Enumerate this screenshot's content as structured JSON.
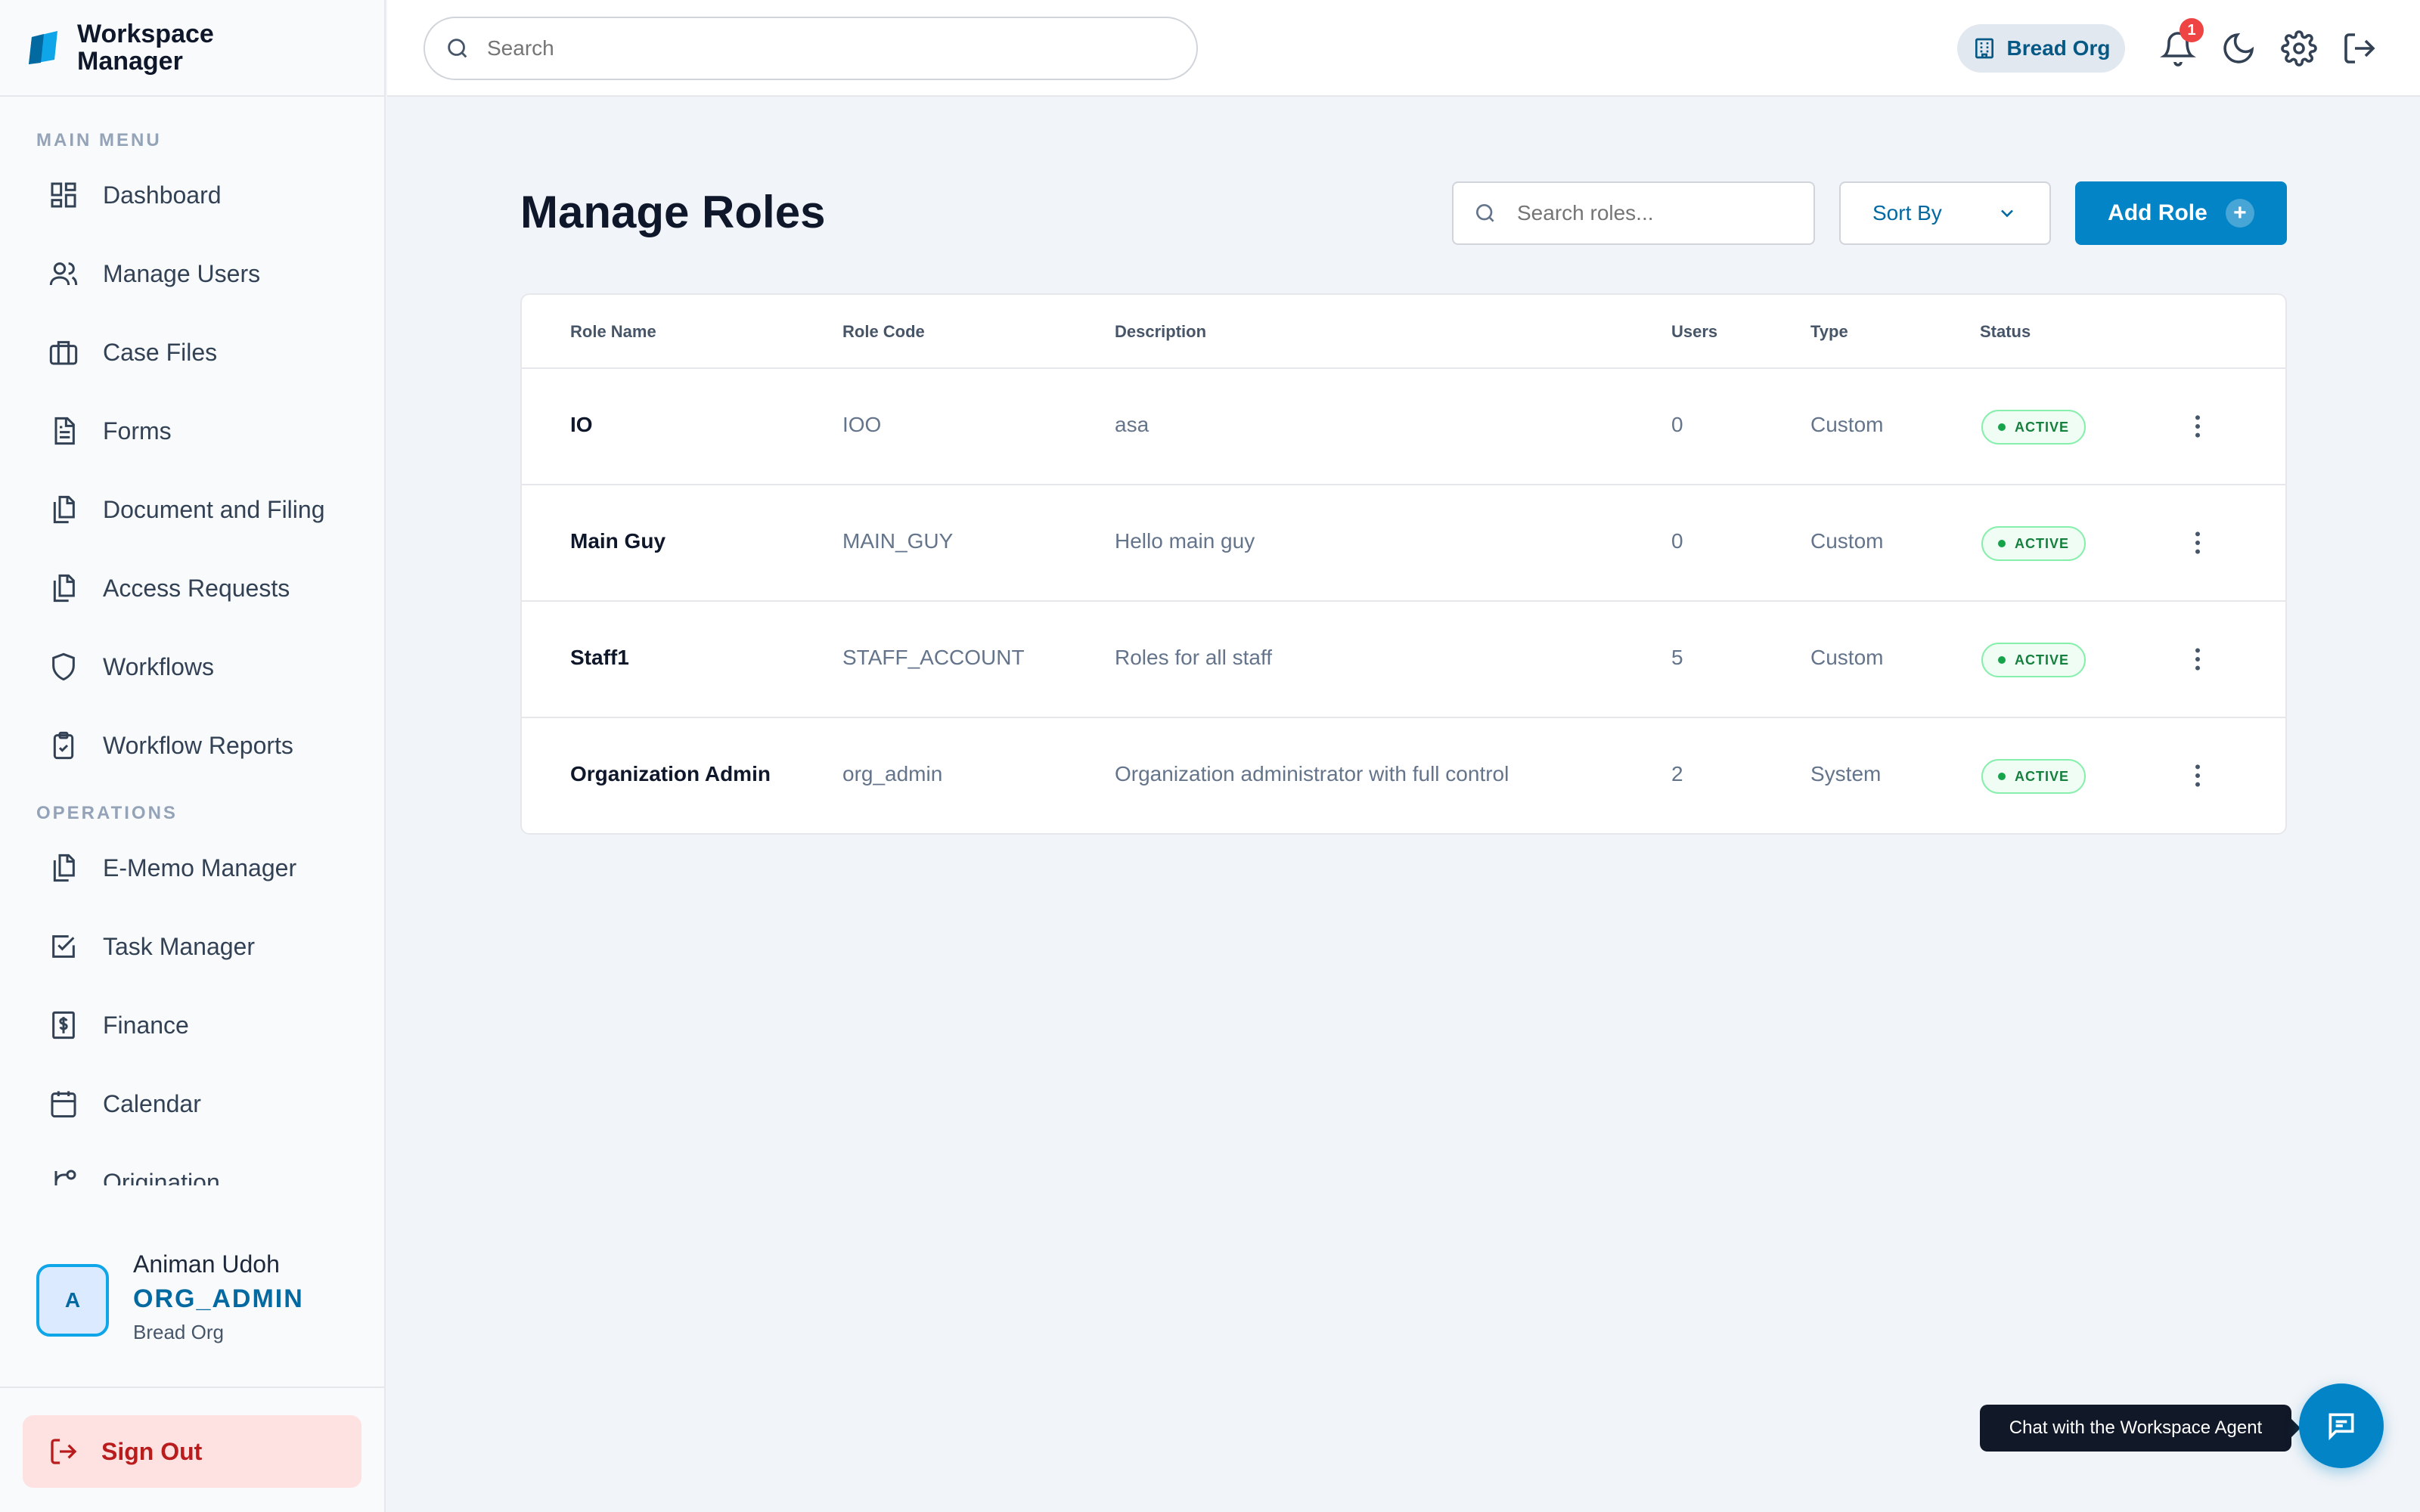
{
  "brand": {
    "line1": "Workspace",
    "line2": "Manager"
  },
  "sidebar": {
    "main_label": "MAIN MENU",
    "main_items": [
      {
        "label": "Dashboard",
        "icon": "dashboard-icon"
      },
      {
        "label": "Manage Users",
        "icon": "users-icon"
      },
      {
        "label": "Case Files",
        "icon": "briefcase-icon"
      },
      {
        "label": "Forms",
        "icon": "document-icon"
      },
      {
        "label": "Document and Filing",
        "icon": "files-icon"
      },
      {
        "label": "Access Requests",
        "icon": "files-icon"
      },
      {
        "label": "Workflows",
        "icon": "shield-icon"
      },
      {
        "label": "Workflow Reports",
        "icon": "clipboard-check-icon"
      }
    ],
    "ops_label": "OPERATIONS",
    "ops_items": [
      {
        "label": "E-Memo Manager",
        "icon": "files-icon"
      },
      {
        "label": "Task Manager",
        "icon": "checkbox-icon"
      },
      {
        "label": "Finance",
        "icon": "dollar-icon"
      },
      {
        "label": "Calendar",
        "icon": "calendar-icon"
      },
      {
        "label": "Origination",
        "icon": "git-branch-icon"
      }
    ],
    "user": {
      "initial": "A",
      "name": "Animan Udoh",
      "role": "ORG_ADMIN",
      "org": "Bread Org"
    },
    "signout_label": "Sign Out"
  },
  "topbar": {
    "search_placeholder": "Search",
    "org_label": "Bread Org",
    "notification_count": "1"
  },
  "main": {
    "title": "Manage Roles",
    "search_placeholder": "Search roles...",
    "sort_label": "Sort By",
    "add_label": "Add Role",
    "columns": [
      "Role Name",
      "Role Code",
      "Description",
      "Users",
      "Type",
      "Status"
    ],
    "rows": [
      {
        "name": "IO",
        "code": "IOO",
        "description": "asa",
        "users": "0",
        "type": "Custom",
        "status": "ACTIVE"
      },
      {
        "name": "Main Guy",
        "code": "MAIN_GUY",
        "description": "Hello main guy",
        "users": "0",
        "type": "Custom",
        "status": "ACTIVE"
      },
      {
        "name": "Staff1",
        "code": "STAFF_ACCOUNT",
        "description": "Roles for all staff",
        "users": "5",
        "type": "Custom",
        "status": "ACTIVE"
      },
      {
        "name": "Organization Admin",
        "code": "org_admin",
        "description": "Organization administrator with full control",
        "users": "2",
        "type": "System",
        "status": "ACTIVE"
      }
    ]
  },
  "chat": {
    "tooltip": "Chat with the Workspace Agent"
  },
  "colors": {
    "accent": "#0284c7",
    "status_active": "#15803d",
    "danger": "#b91c1c"
  }
}
